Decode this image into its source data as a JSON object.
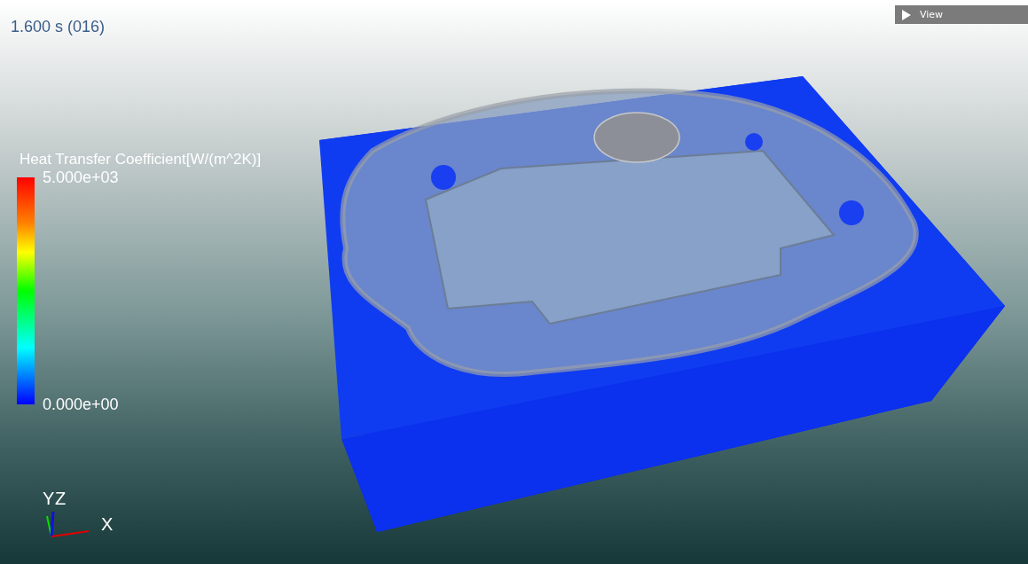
{
  "time_label": "1.600 s (016)",
  "view_button": {
    "label": "View"
  },
  "legend": {
    "title": "Heat Transfer Coefficient[W/(m^2K)]",
    "max_label": "5.000e+03",
    "min_label": "0.000e+00"
  },
  "axes": {
    "y_label": "Y",
    "z_label": "Z",
    "x_label": "X"
  }
}
